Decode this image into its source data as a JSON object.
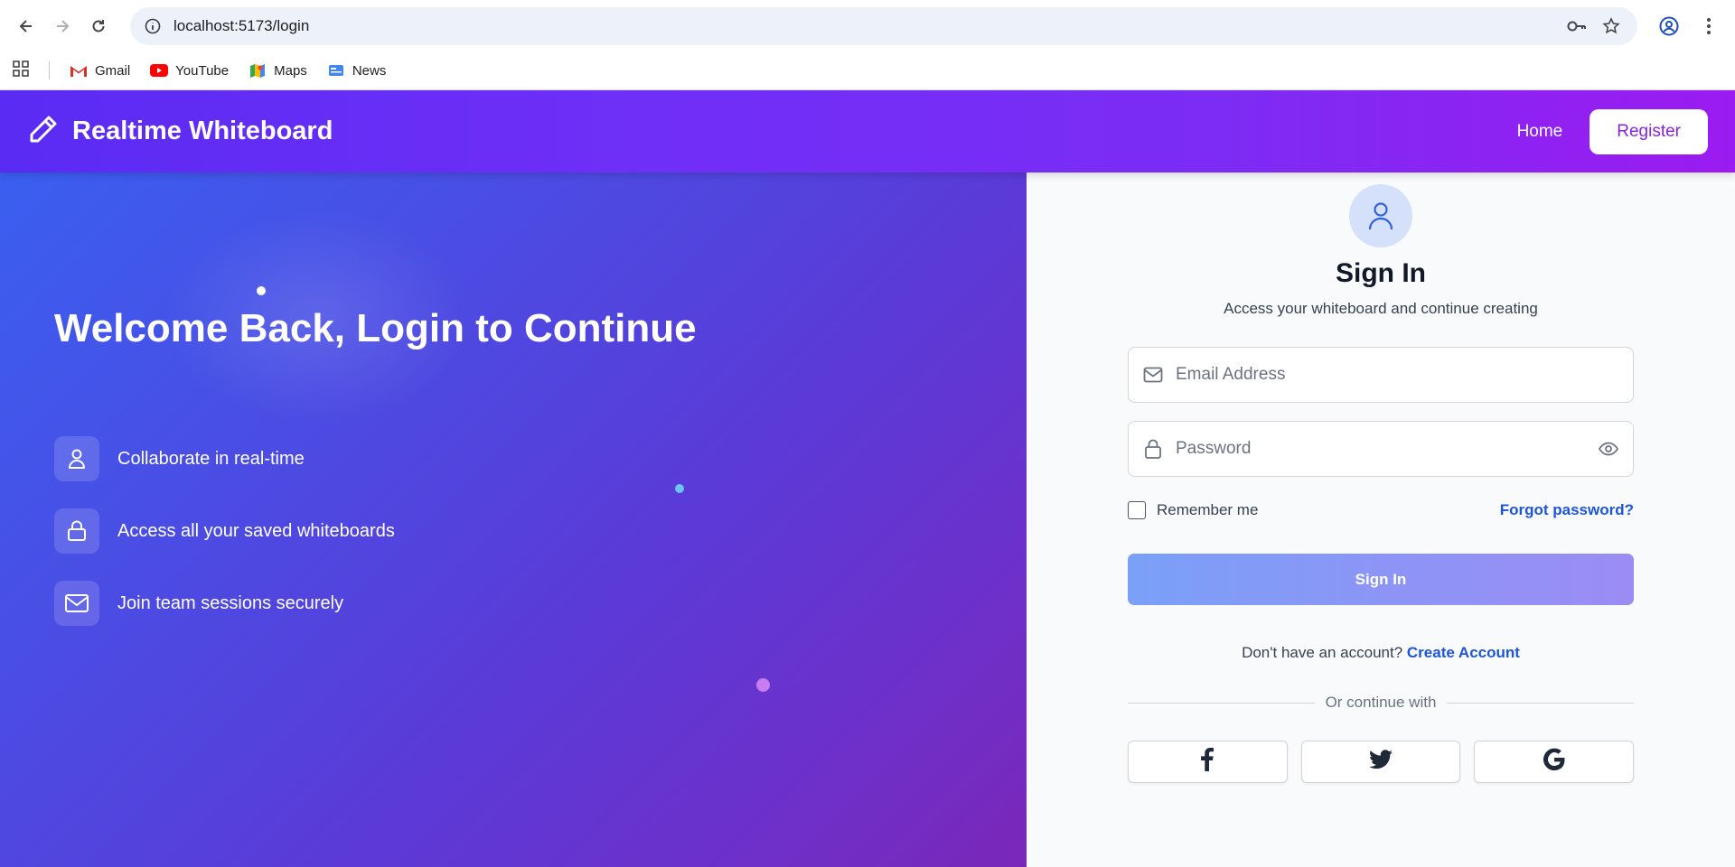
{
  "browser": {
    "url": "localhost:5173/login",
    "bookmarks": [
      {
        "label": "Gmail",
        "icon": "gmail-icon"
      },
      {
        "label": "YouTube",
        "icon": "youtube-icon"
      },
      {
        "label": "Maps",
        "icon": "maps-icon"
      },
      {
        "label": "News",
        "icon": "news-icon"
      }
    ]
  },
  "header": {
    "brand": "Realtime Whiteboard",
    "nav_home": "Home",
    "nav_register": "Register",
    "gradient_start": "#5a2bf3",
    "gradient_end": "#9b1bf0"
  },
  "hero": {
    "title": "Welcome Back, Login to Continue",
    "features": [
      {
        "icon": "user-icon",
        "text": "Collaborate in real-time"
      },
      {
        "icon": "lock-icon",
        "text": "Access all your saved whiteboards"
      },
      {
        "icon": "mail-icon",
        "text": "Join team sessions securely"
      }
    ]
  },
  "signin": {
    "title": "Sign In",
    "subtitle": "Access your whiteboard and continue creating",
    "email_placeholder": "Email Address",
    "password_placeholder": "Password",
    "remember_label": "Remember me",
    "forgot_label": "Forgot password?",
    "submit_label": "Sign In",
    "no_account_text": "Don't have an account?",
    "create_account_label": "Create Account",
    "divider_text": "Or continue with",
    "social": [
      "facebook-icon",
      "twitter-icon",
      "google-icon"
    ],
    "accent_color": "#1d55d8"
  }
}
